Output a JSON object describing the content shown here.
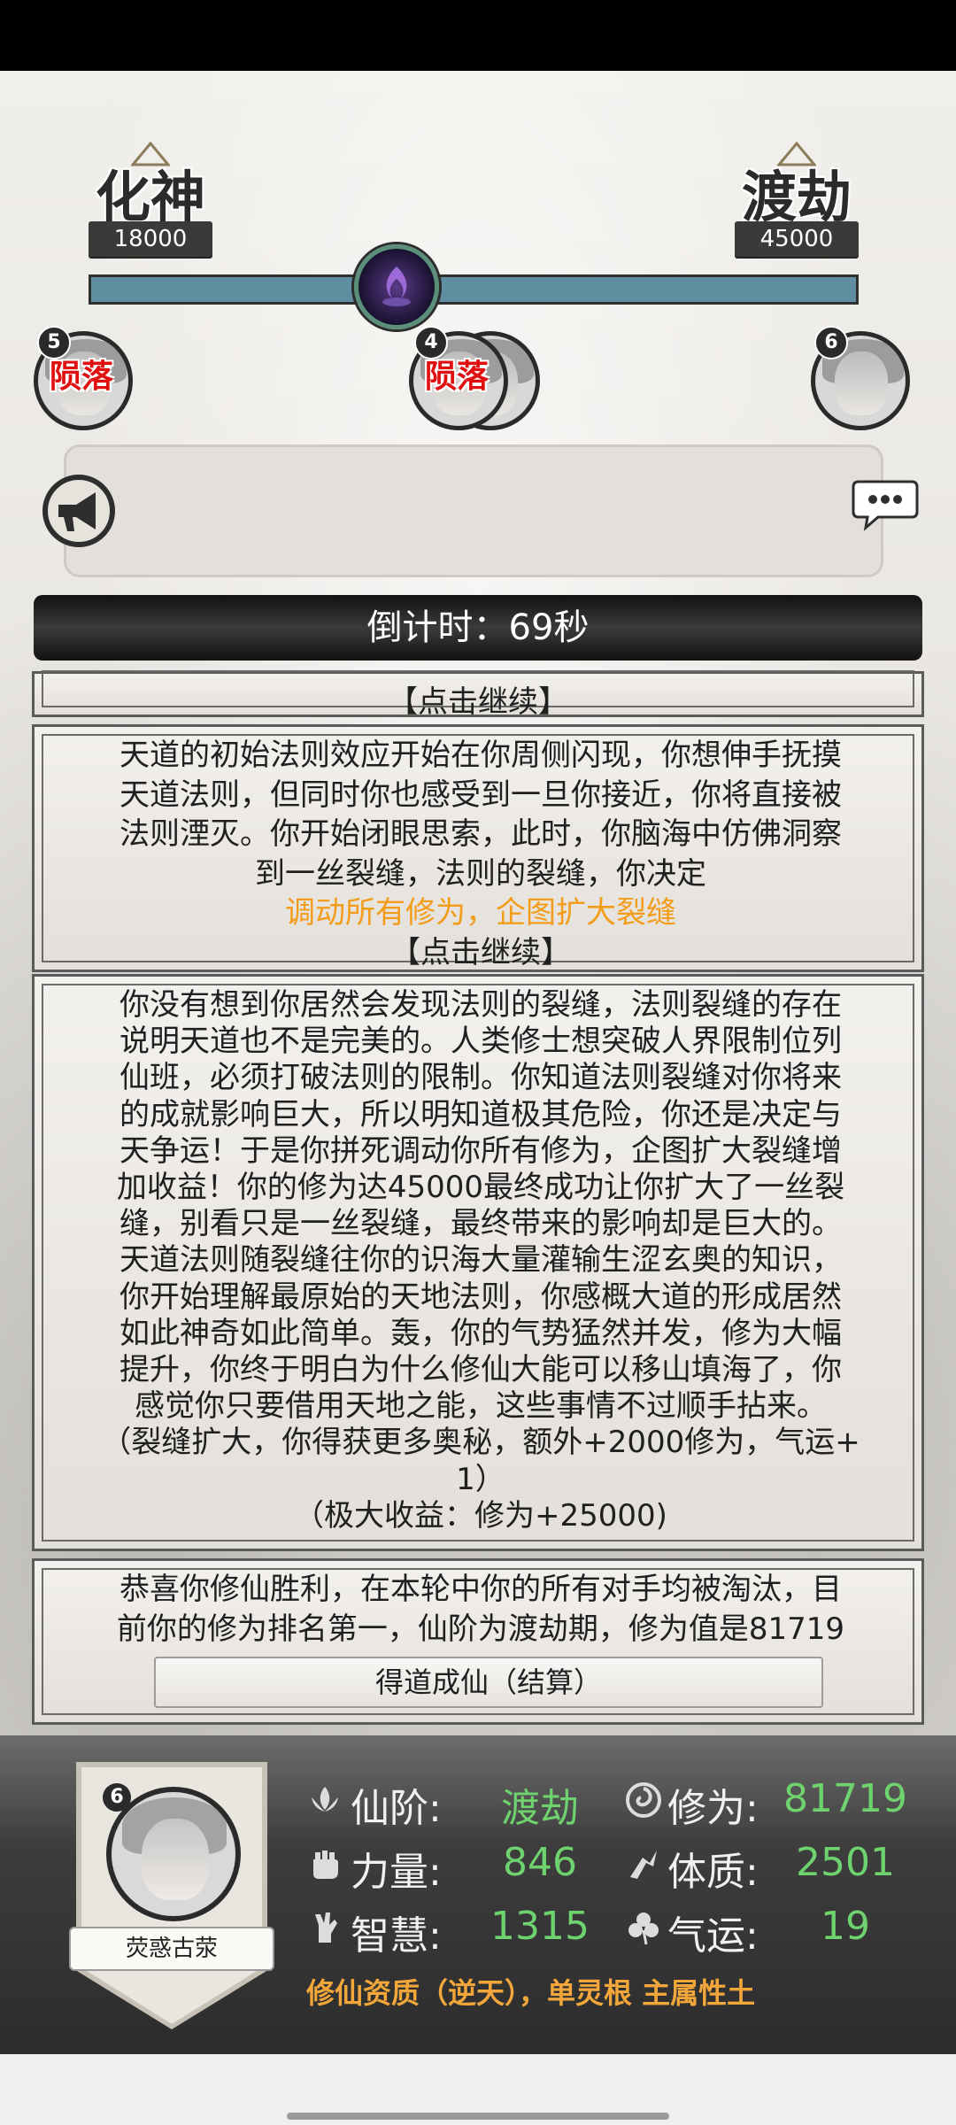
{
  "progress": {
    "left_realm": "化神",
    "left_score": "18000",
    "right_realm": "渡劫",
    "right_score": "45000",
    "marker_fraction": 0.4
  },
  "players": [
    {
      "number": "5",
      "status": "陨落"
    },
    {
      "number": "4",
      "status": "陨落"
    },
    {
      "number": "6",
      "status": ""
    }
  ],
  "countdown": {
    "label": "倒计时：69秒"
  },
  "panels": {
    "p0": {
      "continue": "【点击继续】"
    },
    "p1": {
      "lines": [
        "天道的初始法则效应开始在你周侧闪现，你想伸手抚摸",
        "天道法则，但同时你也感受到一旦你接近，你将直接被",
        "法则湮灭。你开始闭眼思索，此时，你脑海中仿佛洞察",
        "到一丝裂缝，法则的裂缝，你决定"
      ],
      "choice": "调动所有修为，企图扩大裂缝",
      "continue": "【点击继续】"
    },
    "p2": {
      "lines": [
        "你没有想到你居然会发现法则的裂缝，法则裂缝的存在",
        "说明天道也不是完美的。人类修士想突破人界限制位列",
        "仙班，必须打破法则的限制。你知道法则裂缝对你将来",
        "的成就影响巨大，所以明知道极其危险，你还是决定与",
        "天争运！于是你拼死调动你所有修为，企图扩大裂缝增",
        "加收益！你的修为达45000最终成功让你扩大了一丝裂",
        "缝，别看只是一丝裂缝，最终带来的影响却是巨大的。",
        "天道法则随裂缝往你的识海大量灌输生涩玄奥的知识，",
        "你开始理解最原始的天地法则，你感概大道的形成居然",
        "如此神奇如此简单。轰，你的气势猛然并发，修为大幅",
        "提升，你终于明白为什么修仙大能可以移山填海了，你",
        "感觉你只要借用天地之能，这些事情不过顺手拈来。",
        "（裂缝扩大，你得获更多奥秘，额外+2000修为，气运+",
        "1）",
        "（极大收益：修为+25000)"
      ]
    },
    "p3": {
      "lines": [
        "恭喜你修仙胜利，在本轮中你的所有对手均被淘汰，目",
        "前你的修为排名第一，仙阶为渡劫期，修为值是81719"
      ],
      "button": "得道成仙（结算）"
    }
  },
  "me": {
    "number": "6",
    "name": "荧惑古荥",
    "stats": {
      "realm_label": "仙阶:",
      "realm_value": "渡劫",
      "cultivation_label": "修为:",
      "cultivation_value": "81719",
      "strength_label": "力量:",
      "strength_value": "846",
      "constitution_label": "体质:",
      "constitution_value": "2501",
      "wisdom_label": "智慧:",
      "wisdom_value": "1315",
      "luck_label": "气运:",
      "luck_value": "19"
    },
    "aptitude": "修仙资质（逆天），单灵根 主属性土"
  },
  "colors": {
    "accent_orange": "#f39c19",
    "stat_green": "#6ed36e",
    "fallen_red": "#e01010",
    "bar_teal": "#5e8ea0"
  }
}
